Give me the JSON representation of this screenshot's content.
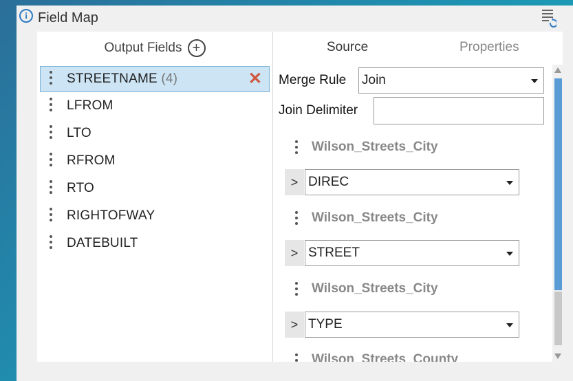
{
  "title_bar": {
    "title": "Field Map",
    "info_icon": "info-icon",
    "reset_icon": "reset-fields-icon"
  },
  "left_pane": {
    "header": "Output Fields",
    "add_icon": "plus-circle-icon",
    "fields": [
      {
        "name": "STREETNAME",
        "count": "(4)",
        "selected": true
      },
      {
        "name": "LFROM",
        "count": ""
      },
      {
        "name": "LTO",
        "count": ""
      },
      {
        "name": "RFROM",
        "count": ""
      },
      {
        "name": "RTO",
        "count": ""
      },
      {
        "name": "RIGHTOFWAY",
        "count": ""
      },
      {
        "name": "DATEBUILT",
        "count": ""
      }
    ],
    "remove_symbol": "✕"
  },
  "right_pane": {
    "tabs": [
      {
        "label": "Source",
        "active": true
      },
      {
        "label": "Properties",
        "active": false
      }
    ],
    "merge_rule": {
      "label": "Merge Rule",
      "value": "Join"
    },
    "join_delimiter": {
      "label": "Join Delimiter",
      "value": ""
    },
    "sources": [
      {
        "table": "Wilson_Streets_City",
        "field": "DIREC"
      },
      {
        "table": "Wilson_Streets_City",
        "field": "STREET"
      },
      {
        "table": "Wilson_Streets_City",
        "field": "TYPE"
      },
      {
        "table": "Wilson_Streets_County",
        "field": ""
      }
    ],
    "expand_symbol": ">"
  },
  "colors": {
    "accent": "#2f79c4",
    "selected_row": "#cce4f4",
    "remove": "#d0573d",
    "scroll_thumb": "#5b9bd5"
  }
}
